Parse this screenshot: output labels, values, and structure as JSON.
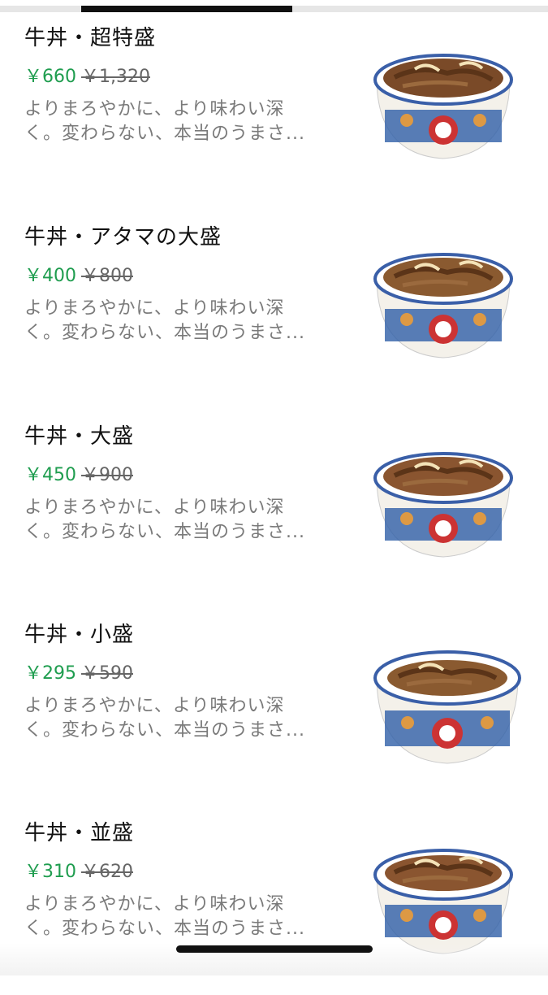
{
  "items": [
    {
      "title": "牛丼・超特盛",
      "price": "￥660",
      "original_price": "￥1,320",
      "desc_line1": "よりまろやかに、より味わい深",
      "desc_line2": "く。変わらない、本当のうまさ..."
    },
    {
      "title": "牛丼・アタマの大盛",
      "price": "￥400",
      "original_price": "￥800",
      "desc_line1": "よりまろやかに、より味わい深",
      "desc_line2": "く。変わらない、本当のうまさ..."
    },
    {
      "title": "牛丼・大盛",
      "price": "￥450",
      "original_price": "￥900",
      "desc_line1": "よりまろやかに、より味わい深",
      "desc_line2": "く。変わらない、本当のうまさ..."
    },
    {
      "title": "牛丼・小盛",
      "price": "￥295",
      "original_price": "￥590",
      "desc_line1": "よりまろやかに、より味わい深",
      "desc_line2": "く。変わらない、本当のうまさ..."
    },
    {
      "title": "牛丼・並盛",
      "price": "￥310",
      "original_price": "￥620",
      "desc_line1": "よりまろやかに、より味わい深",
      "desc_line2": "く。変わらない、本当のうまさ..."
    }
  ],
  "colors": {
    "price": "#1f9d4f",
    "original_price": "#666666",
    "description": "#7a7a7a"
  },
  "icons": {
    "item_image": "gyudon-bowl-image"
  }
}
